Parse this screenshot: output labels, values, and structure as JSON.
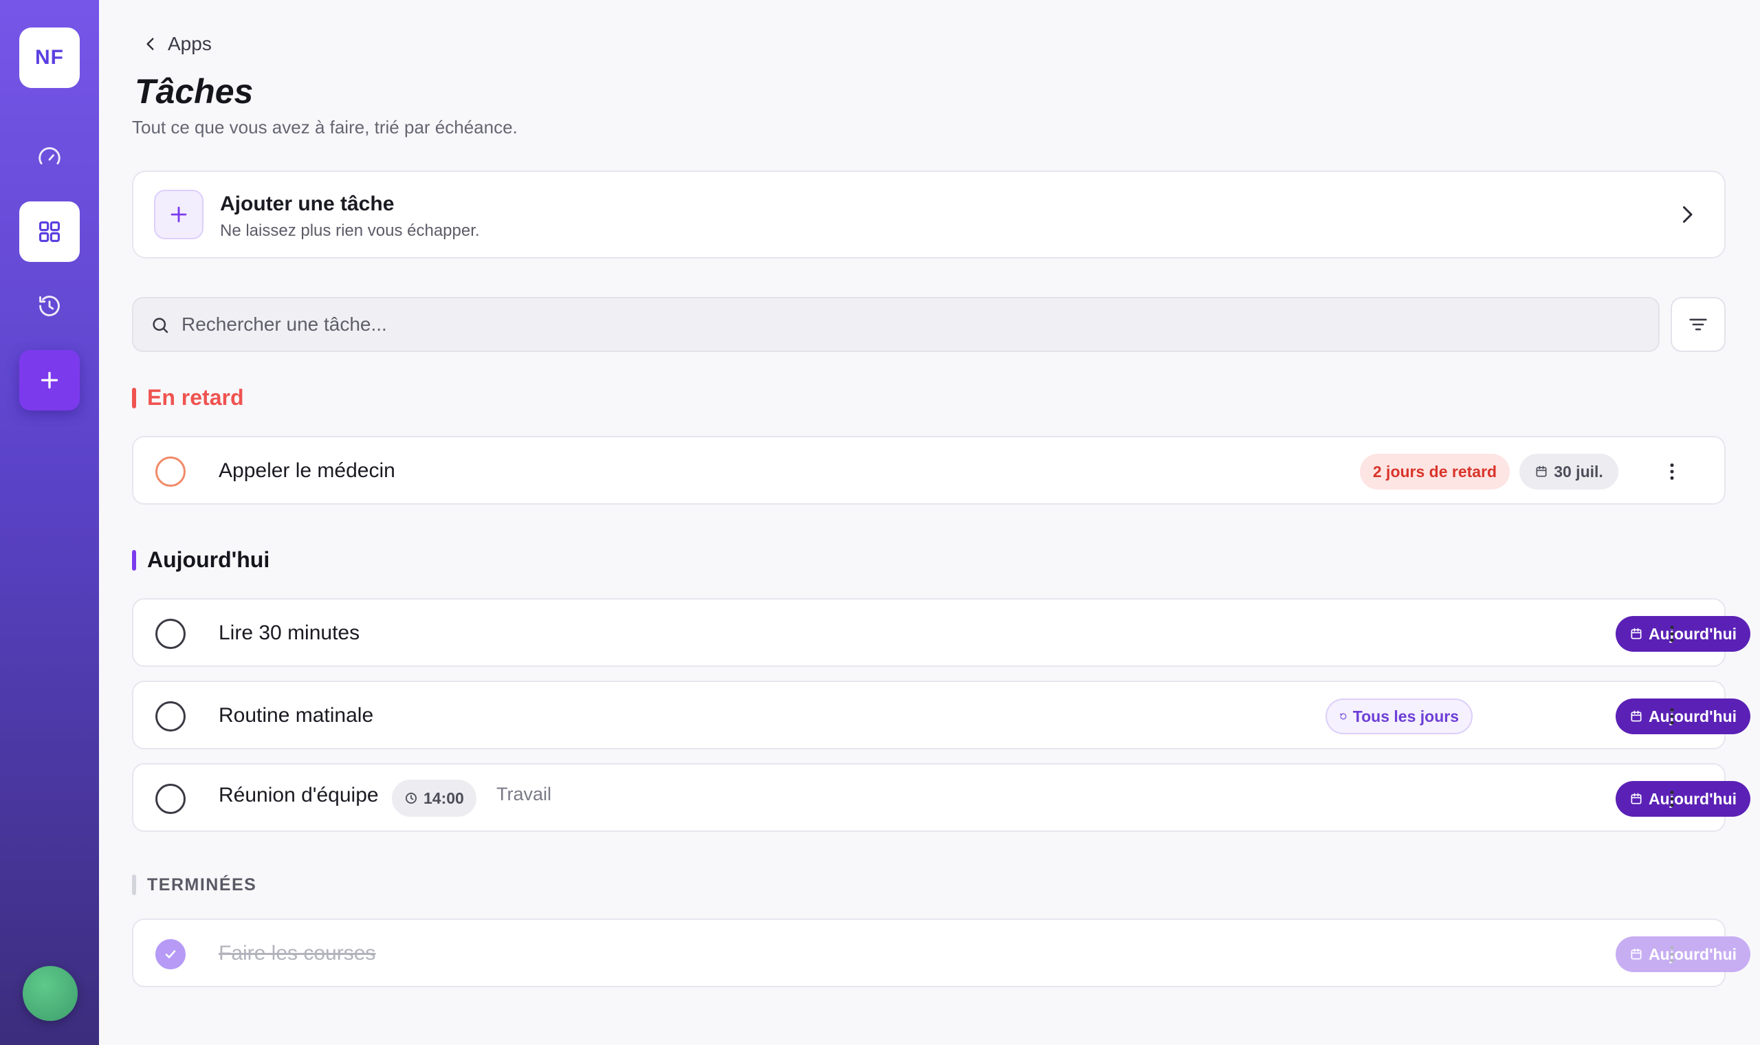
{
  "sidebar": {
    "logo": "NF",
    "items": [
      {
        "icon": "gauge-icon"
      },
      {
        "icon": "grid-icon",
        "active": true
      },
      {
        "icon": "history-icon"
      },
      {
        "icon": "plus-icon"
      }
    ]
  },
  "breadcrumb": {
    "back_label": "Apps"
  },
  "page": {
    "title": "Tâches",
    "subtitle": "Tout ce que vous avez à faire, trié par échéance."
  },
  "add_task": {
    "title": "Ajouter une tâche",
    "subtitle": "Ne laissez plus rien vous échapper."
  },
  "search": {
    "placeholder": "Rechercher une tâche...",
    "value": ""
  },
  "sections": {
    "overdue": {
      "title": "En retard",
      "tasks": [
        {
          "name": "Appeler le médecin",
          "late_badge": "2 jours de retard",
          "date_badge": "30 juil."
        }
      ]
    },
    "today": {
      "title": "Aujourd'hui",
      "tasks": [
        {
          "name": "Lire 30 minutes",
          "due_badge": "Aujourd'hui"
        },
        {
          "name": "Routine matinale",
          "repeat_badge": "Tous les jours",
          "due_badge": "Aujourd'hui"
        },
        {
          "name": "Réunion d'équipe",
          "time_badge": "14:00",
          "tag": "Travail",
          "due_badge": "Aujourd'hui"
        }
      ]
    },
    "done": {
      "title": "TERMINÉES",
      "tasks": [
        {
          "name": "Faire les courses",
          "due_badge": "Aujourd'hui",
          "completed": true
        }
      ]
    }
  },
  "colors": {
    "accent": "#7c3aed",
    "accent_dark": "#5b21b6",
    "overdue": "#ef5350",
    "sidebar_top": "#7656e8",
    "sidebar_bottom": "#3c2d7d"
  }
}
